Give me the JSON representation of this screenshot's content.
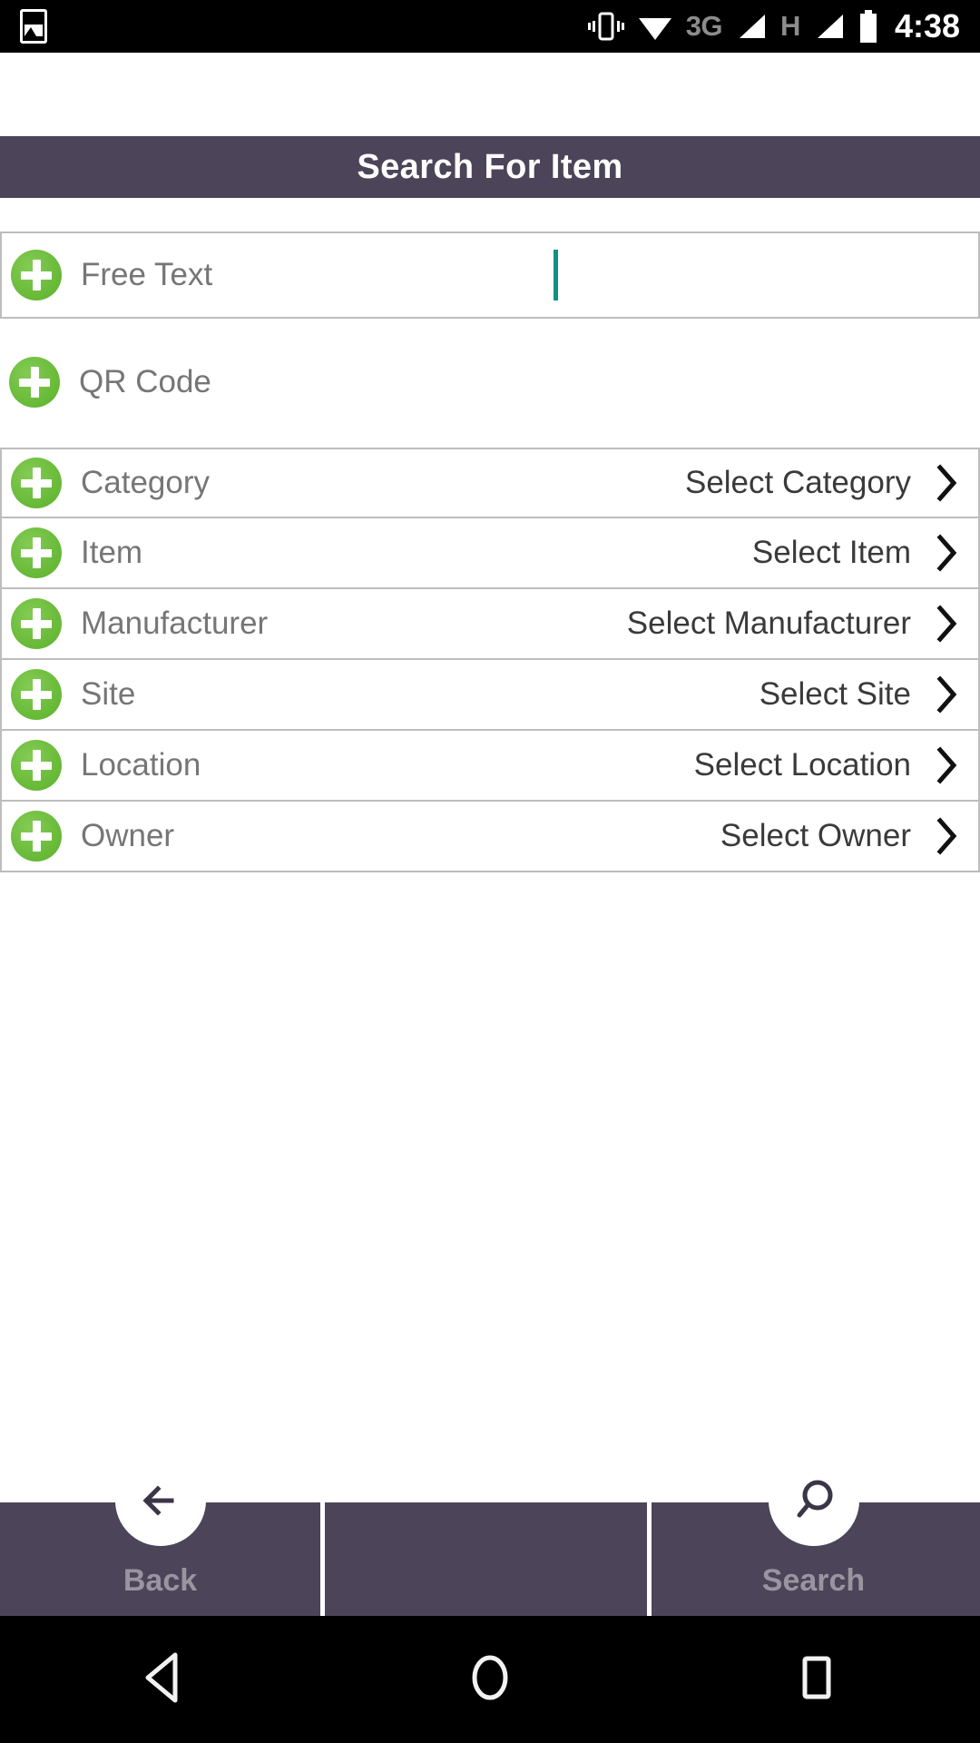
{
  "status_bar": {
    "left_icons": [
      "image-icon"
    ],
    "right_icons": [
      "vibrate-icon",
      "wifi-icon",
      "signal-icon",
      "signal-icon-2",
      "battery-icon"
    ],
    "network_3g_label": "3G",
    "network_h_label": "H",
    "clock": "4:38"
  },
  "header": {
    "title": "Search For Item",
    "background_color": "#4c4458",
    "text_color": "#ffffff"
  },
  "colors": {
    "accent_green": "#63b733",
    "caret_teal": "#109182",
    "bar_purple": "#4c4458",
    "label_gray": "#767676",
    "value_dark": "#3a3a3a",
    "border_gray": "#bdbdbd"
  },
  "fields": [
    {
      "label": "Free Text",
      "value": "",
      "placeholder": "",
      "type": "text-input",
      "has_chevron": false,
      "has_caret": true,
      "style": "boxed",
      "icon": "plus-circle-icon"
    },
    {
      "label": "QR Code",
      "value": "",
      "type": "scan",
      "has_chevron": false,
      "has_caret": false,
      "style": "plain",
      "icon": "plus-circle-icon"
    },
    {
      "label": "Category",
      "value": "Select Category",
      "type": "picker",
      "has_chevron": true,
      "has_caret": false,
      "style": "grouped-first",
      "icon": "plus-circle-icon"
    },
    {
      "label": "Item",
      "value": "Select Item",
      "type": "picker",
      "has_chevron": true,
      "has_caret": false,
      "style": "grouped",
      "icon": "plus-circle-icon"
    },
    {
      "label": "Manufacturer",
      "value": "Select Manufacturer",
      "type": "picker",
      "has_chevron": true,
      "has_caret": false,
      "style": "grouped",
      "icon": "plus-circle-icon"
    },
    {
      "label": "Site",
      "value": "Select Site",
      "type": "picker",
      "has_chevron": true,
      "has_caret": false,
      "style": "grouped",
      "icon": "plus-circle-icon"
    },
    {
      "label": "Location",
      "value": "Select Location",
      "type": "picker",
      "has_chevron": true,
      "has_caret": false,
      "style": "grouped",
      "icon": "plus-circle-icon"
    },
    {
      "label": "Owner",
      "value": "Select Owner",
      "type": "picker",
      "has_chevron": true,
      "has_caret": false,
      "style": "grouped",
      "icon": "plus-circle-icon"
    }
  ],
  "bottom_bar": {
    "back_label": "Back",
    "back_icon": "arrow-left-icon",
    "middle_label": "",
    "search_label": "Search",
    "search_icon": "magnifier-icon"
  },
  "nav_bar": {
    "back_icon": "triangle-back-icon",
    "home_icon": "circle-home-icon",
    "recents_icon": "square-recents-icon"
  }
}
